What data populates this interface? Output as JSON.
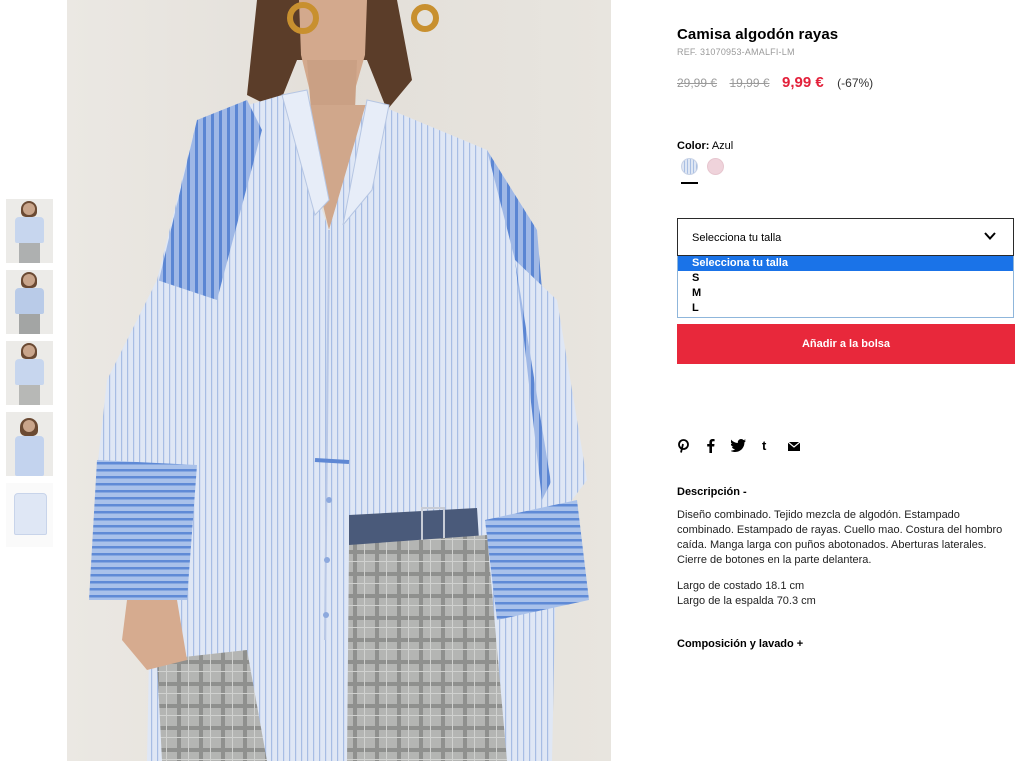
{
  "product": {
    "title": "Camisa algodón rayas",
    "ref": "REF. 31070953-AMALFI-LM",
    "price_original": "29,99 €",
    "price_previous": "19,99 €",
    "price_sale": "9,99 €",
    "discount": "(-67%)"
  },
  "color": {
    "label": "Color:",
    "value": "Azul",
    "swatches": [
      "blue-stripe",
      "pink"
    ]
  },
  "size": {
    "placeholder": "Selecciona tu talla",
    "options": [
      "Selecciona tu talla",
      "S",
      "M",
      "L"
    ],
    "selected_index": 0
  },
  "cart": {
    "add_label": "Añadir a la bolsa"
  },
  "share": {
    "icons": [
      "pinterest-icon",
      "facebook-icon",
      "twitter-icon",
      "tumblr-icon",
      "email-icon"
    ],
    "glyphs": [
      "℗",
      "f",
      "🐦",
      "t",
      "✉"
    ]
  },
  "description": {
    "heading": "Descripción -",
    "text": "Diseño combinado. Tejido mezcla de algodón. Estampado combinado. Estampado de rayas. Cuello mao. Costura del hombro caída. Manga larga con puños abotonados. Aberturas laterales. Cierre de botones en la parte delantera.",
    "measure_1": "Largo de costado 18.1 cm",
    "measure_2": "Largo de la espalda 70.3 cm"
  },
  "composition": {
    "heading": "Composición y lavado +"
  },
  "colors": {
    "accent": "#e8283b",
    "sale_price": "#e3203a",
    "dropdown_highlight": "#1a73e8"
  }
}
